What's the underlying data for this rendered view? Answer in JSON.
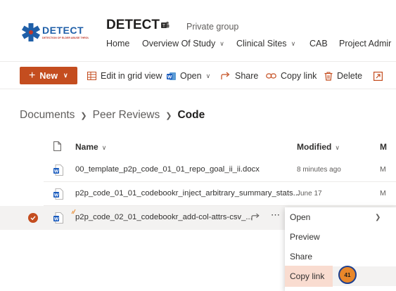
{
  "header": {
    "logo_text": "DETECT",
    "logo_tagline": "DETECTION OF ELDER ABUSE THROUGH EMERGENCY CARE TECHNICIANS",
    "site_title": "DETECT",
    "group_type": "Private group",
    "nav": [
      {
        "label": "Home",
        "has_dropdown": false
      },
      {
        "label": "Overview Of Study",
        "has_dropdown": true
      },
      {
        "label": "Clinical Sites",
        "has_dropdown": true
      },
      {
        "label": "CAB",
        "has_dropdown": false
      },
      {
        "label": "Project Admir",
        "has_dropdown": false
      }
    ]
  },
  "toolbar": {
    "new_label": "New",
    "edit_grid_label": "Edit in grid view",
    "open_label": "Open",
    "share_label": "Share",
    "copy_link_label": "Copy link",
    "delete_label": "Delete"
  },
  "breadcrumb": {
    "items": [
      "Documents",
      "Peer Reviews"
    ],
    "current": "Code"
  },
  "list": {
    "columns": {
      "name": "Name",
      "modified": "Modified",
      "extra": "M"
    },
    "rows": [
      {
        "name": "00_template_p2p_code_01_01_repo_goal_ii_ii.docx",
        "modified": "8 minutes ago",
        "extra": "M",
        "selected": false
      },
      {
        "name": "p2p_code_01_01_codebookr_inject_arbitrary_summary_stats...",
        "modified": "June 17",
        "extra": "M",
        "selected": false
      },
      {
        "name": "p2p_code_02_01_codebookr_add-col-attrs-csv_...",
        "modified": "",
        "extra": "",
        "selected": true
      }
    ]
  },
  "context_menu": {
    "items": [
      {
        "label": "Open",
        "submenu": true
      },
      {
        "label": "Preview",
        "submenu": false
      },
      {
        "label": "Share",
        "submenu": false
      },
      {
        "label": "Copy link",
        "submenu": false
      }
    ]
  },
  "step_badge": "41",
  "colors": {
    "accent": "#c44d1f",
    "brand_blue": "#1f5fa8",
    "badge_fill": "#e8872a",
    "badge_ring": "#1d3f8f",
    "highlight": "#f9dcd0"
  }
}
